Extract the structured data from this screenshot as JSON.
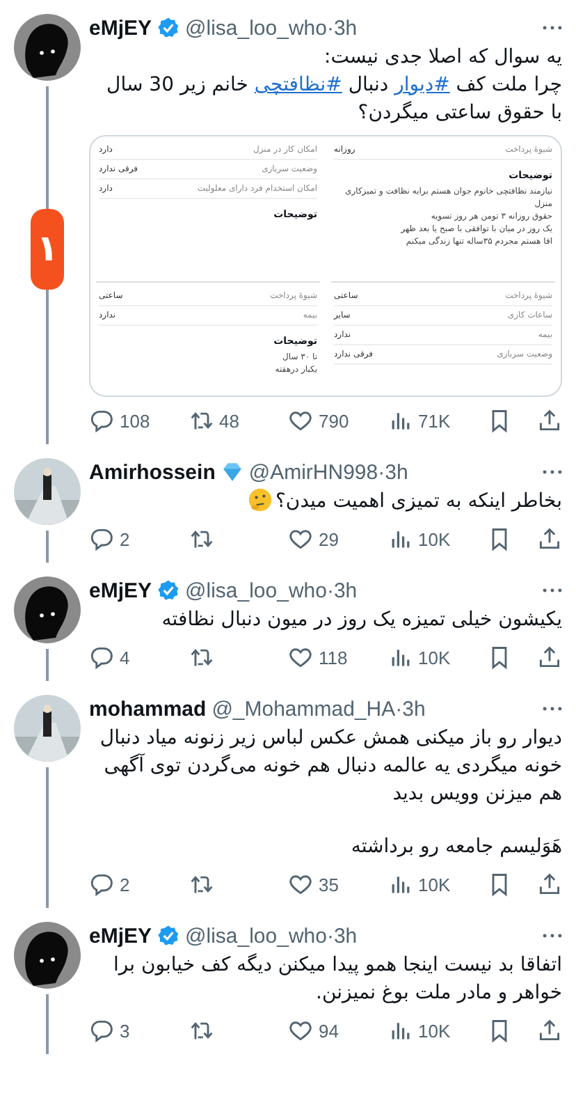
{
  "tweets": [
    {
      "name": "eMjEY",
      "badge": {
        "kind": "verified"
      },
      "meta": "@lisa_loo_who·3h",
      "avatar": {
        "kind": "silhouette"
      },
      "paragraphs": [
        [
          {
            "kind": "text",
            "text": "یه سوال که اصلا جدی نیست:"
          },
          {
            "kind": "break"
          },
          {
            "kind": "text",
            "text": "چرا ملت کف "
          },
          {
            "kind": "hashtag",
            "text": "#دیوار"
          },
          {
            "kind": "text",
            "text": " دنبال "
          },
          {
            "kind": "hashtag",
            "text": "#نظافتچی"
          },
          {
            "kind": "text",
            "text": " خانم زیر 30 سال با حقوق ساعتی میگردن؟"
          }
        ]
      ],
      "overlay_badge": "۱",
      "media": {
        "columns": [
          {
            "blocks": [
              {
                "rows": [
                  {
                    "label": "شیوهٔ پرداخت",
                    "value": "روزانه"
                  }
                ],
                "heading": "توضیحات",
                "lines": [
                  "نیازمند نظافتچی خانوم جوان هستم برایه نظافت و تمیزکاری منزل",
                  "حقوق روزانه ۳ تومن هر روز تسویه",
                  "یک روز در میان  با توافقی با صبح یا بعد ظهر",
                  "اقا هستم مجردم ۳۵ساله تنها زندگی میکنم"
                ]
              },
              {
                "rows": [
                  {
                    "label": "شیوهٔ پرداخت",
                    "value": "ساعتی"
                  },
                  {
                    "label": "ساعات کاری",
                    "value": "سایر"
                  },
                  {
                    "label": "بیمه",
                    "value": "ندارد"
                  },
                  {
                    "label": "وضعیت سربازی",
                    "value": "فرقی ندارد"
                  }
                ]
              }
            ]
          },
          {
            "blocks": [
              {
                "rows": [
                  {
                    "label": "امکان کار در منزل",
                    "value": "دارد"
                  },
                  {
                    "label": "وضعیت سربازی",
                    "value": "فرقی ندارد"
                  },
                  {
                    "label": "امکان استخدام فرد دارای معلولیت",
                    "value": "دارد"
                  }
                ],
                "heading": "توضیحات"
              },
              {
                "rows": [
                  {
                    "label": "شیوهٔ پرداخت",
                    "value": "ساعتی"
                  },
                  {
                    "label": "بیمه",
                    "value": "ندارد"
                  }
                ],
                "heading": "توضیحات",
                "lines": [
                  "تا ۳۰ سال",
                  "یکبار درهفته"
                ]
              }
            ]
          }
        ]
      },
      "stats": {
        "replies": "108",
        "retweets": "48",
        "likes": "790",
        "views": "71K"
      }
    },
    {
      "name": "Amirhossein",
      "badge": {
        "kind": "diamond"
      },
      "meta": "@AmirHN998·3h",
      "avatar": {
        "kind": "picture"
      },
      "paragraphs": [
        [
          {
            "kind": "text",
            "text": "بخاطر اینکه به تمیزی اهمیت میدن؟"
          },
          {
            "kind": "emoji"
          }
        ]
      ],
      "stats": {
        "replies": "2",
        "likes": "29",
        "views": "10K"
      }
    },
    {
      "name": "eMjEY",
      "badge": {
        "kind": "verified"
      },
      "meta": "@lisa_loo_who·3h",
      "avatar": {
        "kind": "silhouette"
      },
      "paragraphs": [
        [
          {
            "kind": "text",
            "text": "یکیشون خیلی تمیزه یک روز در میون دنبال نظافته"
          }
        ]
      ],
      "stats": {
        "replies": "4",
        "likes": "118",
        "views": "10K"
      }
    },
    {
      "name": "mohammad",
      "meta": "@_Mohammad_HA·3h",
      "avatar": {
        "kind": "picture"
      },
      "paragraphs": [
        [
          {
            "kind": "text",
            "text": "دیوار رو باز میکنی همش عکس لباس زیر زنونه میاد دنبال خونه میگردی یه عالمه دنبال هم خونه می‌گردن توی آگهی هم میزنن وویس بدید"
          }
        ],
        [
          {
            "kind": "text",
            "text": "هَوَلیسم جامعه رو برداشته"
          }
        ]
      ],
      "stats": {
        "replies": "2",
        "likes": "35",
        "views": "10K"
      }
    },
    {
      "name": "eMjEY",
      "badge": {
        "kind": "verified"
      },
      "meta": "@lisa_loo_who·3h",
      "avatar": {
        "kind": "silhouette"
      },
      "paragraphs": [
        [
          {
            "kind": "text",
            "text": "اتفاقا بد نیست اینجا همو پیدا میکنن دیگه کف خیابون برا خواهر و مادر ملت بوغ نمیزنن."
          }
        ]
      ],
      "stats": {
        "replies": "3",
        "likes": "94",
        "views": "10K"
      }
    }
  ]
}
